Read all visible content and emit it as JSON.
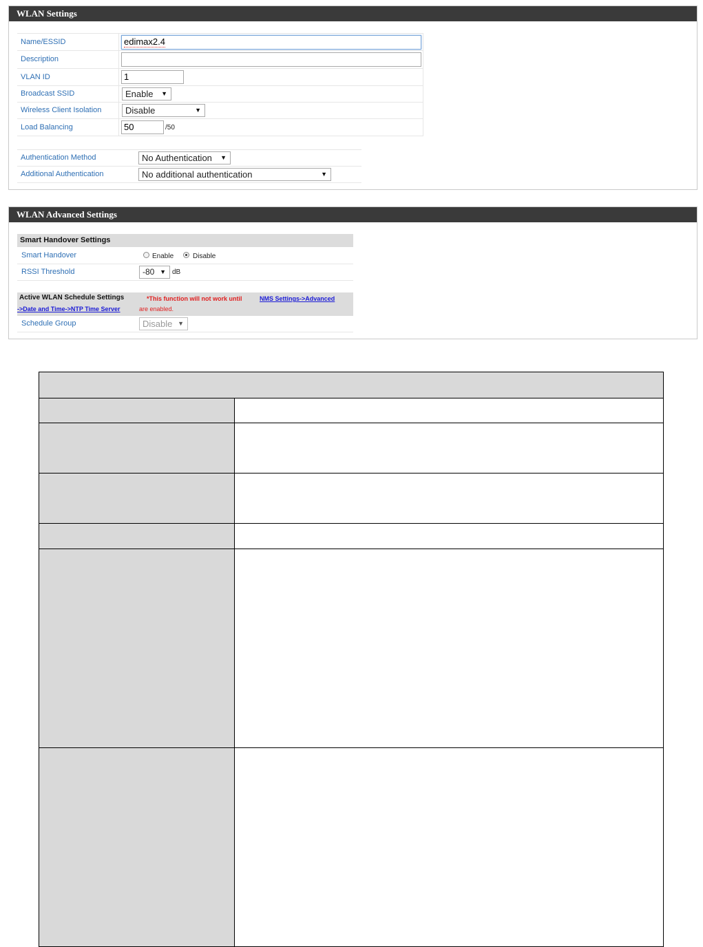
{
  "wlan_settings": {
    "title": "WLAN Settings",
    "fields": {
      "name_essid": {
        "label": "Name/ESSID",
        "value": "edimax2.4"
      },
      "description": {
        "label": "Description",
        "value": ""
      },
      "vlan_id": {
        "label": "VLAN ID",
        "value": "1"
      },
      "broadcast_ssid": {
        "label": "Broadcast SSID",
        "selected": "Enable"
      },
      "wireless_client_isolation": {
        "label": "Wireless Client Isolation",
        "selected": "Disable"
      },
      "load_balancing": {
        "label": "Load Balancing",
        "value": "50",
        "suffix": "/50"
      },
      "authentication_method": {
        "label": "Authentication Method",
        "selected": "No Authentication"
      },
      "additional_authentication": {
        "label": "Additional Authentication",
        "selected": "No additional authentication"
      }
    }
  },
  "wlan_advanced": {
    "title": "WLAN Advanced Settings",
    "smart_handover": {
      "heading": "Smart Handover Settings",
      "label": "Smart Handover",
      "enable_label": "Enable",
      "disable_label": "Disable",
      "selected": "Disable",
      "rssi_label": "RSSI Threshold",
      "rssi_value": "-80",
      "rssi_unit": "dB"
    },
    "schedule": {
      "heading": "Active WLAN Schedule Settings",
      "warning_prefix": "*This function will not work until",
      "link_part1": "NMS Settings->Advanced",
      "link_part2": "->Date and Time->NTP Time Server",
      "warning_suffix": "are enabled.",
      "group_label": "Schedule Group",
      "group_value": "Disable"
    }
  },
  "icons": {
    "caret": "dropdown-caret-icon",
    "radio": "radio-button-icon"
  },
  "colors": {
    "header_bg": "#3a3a3a",
    "label_blue": "#2e6fb4",
    "warning_red": "#e02020",
    "link_blue": "#1a1ad6",
    "table_gray": "#d9d9d9"
  }
}
